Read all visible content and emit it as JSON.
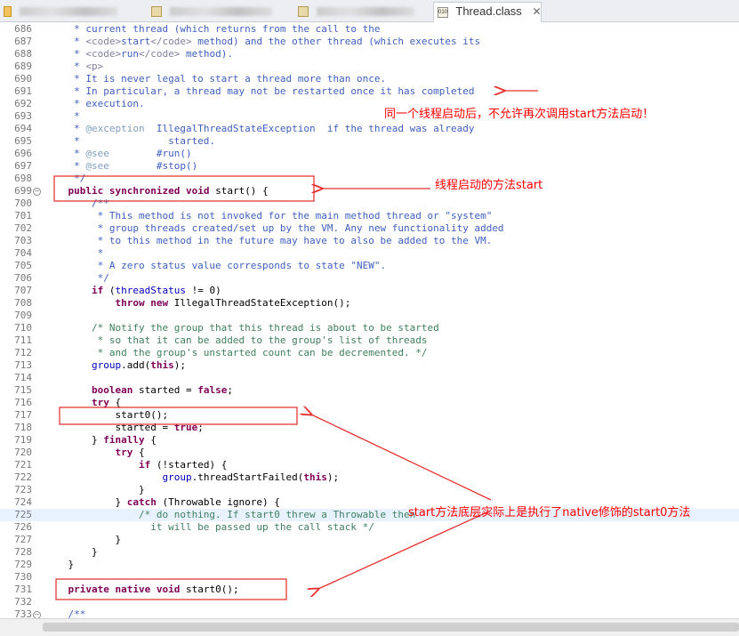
{
  "tabs": [
    {
      "label": "",
      "icon": "java-file-icon",
      "active": false
    },
    {
      "label": "",
      "icon": "class-file-icon",
      "active": false
    },
    {
      "label": "",
      "icon": "class-file-icon",
      "active": false
    },
    {
      "label": "Thread.class",
      "icon": "class-file-icon",
      "active": true,
      "close": "✕"
    }
  ],
  "code_lines": [
    {
      "n": "686",
      "t": [
        [
          "c-cm",
          "     * current thread (which returns from the call to the"
        ]
      ]
    },
    {
      "n": "687",
      "t": [
        [
          "c-cm",
          "     * "
        ],
        [
          "c-tag",
          "<code>"
        ],
        [
          "c-cm",
          "start"
        ],
        [
          "c-tag",
          "</code>"
        ],
        [
          "c-cm",
          " method) and the other thread (which executes its"
        ]
      ]
    },
    {
      "n": "688",
      "t": [
        [
          "c-cm",
          "     * "
        ],
        [
          "c-tag",
          "<code>"
        ],
        [
          "c-cm",
          "run"
        ],
        [
          "c-tag",
          "</code>"
        ],
        [
          "c-cm",
          " method)."
        ]
      ]
    },
    {
      "n": "689",
      "t": [
        [
          "c-cm",
          "     * "
        ],
        [
          "c-tag",
          "<p>"
        ]
      ]
    },
    {
      "n": "690",
      "t": [
        [
          "c-cm",
          "     * It is never legal to start a thread more than once."
        ]
      ]
    },
    {
      "n": "691",
      "t": [
        [
          "c-cm",
          "     * In particular, a thread may not be restarted once it has completed"
        ]
      ]
    },
    {
      "n": "692",
      "t": [
        [
          "c-cm",
          "     * execution."
        ]
      ]
    },
    {
      "n": "693",
      "t": [
        [
          "c-cm",
          "     *"
        ]
      ]
    },
    {
      "n": "694",
      "t": [
        [
          "c-cm",
          "     * "
        ],
        [
          "c-jd",
          "@exception"
        ],
        [
          "c-cm",
          "  IllegalThreadStateException  if the thread was already"
        ]
      ]
    },
    {
      "n": "695",
      "t": [
        [
          "c-cm",
          "     *               started."
        ]
      ]
    },
    {
      "n": "696",
      "t": [
        [
          "c-cm",
          "     * "
        ],
        [
          "c-jd",
          "@see"
        ],
        [
          "c-cm",
          "        #run()"
        ]
      ]
    },
    {
      "n": "697",
      "t": [
        [
          "c-cm",
          "     * "
        ],
        [
          "c-jd",
          "@see"
        ],
        [
          "c-cm",
          "        #stop()"
        ]
      ]
    },
    {
      "n": "698",
      "t": [
        [
          "c-cm",
          "     */"
        ]
      ]
    },
    {
      "n": "699",
      "fold": "−",
      "t": [
        [
          "c-pl",
          "    "
        ],
        [
          "c-kw",
          "public synchronized void"
        ],
        [
          "c-pl",
          " start() {"
        ]
      ]
    },
    {
      "n": "700",
      "t": [
        [
          "c-cm",
          "        /**"
        ]
      ]
    },
    {
      "n": "701",
      "t": [
        [
          "c-cm",
          "         * This method is not invoked for the main method thread or \"system\""
        ]
      ]
    },
    {
      "n": "702",
      "t": [
        [
          "c-cm",
          "         * group threads created/set up by the VM. Any new functionality added"
        ]
      ]
    },
    {
      "n": "703",
      "t": [
        [
          "c-cm",
          "         * to this method in the future may have to also be added to the VM."
        ]
      ]
    },
    {
      "n": "704",
      "t": [
        [
          "c-cm",
          "         *"
        ]
      ]
    },
    {
      "n": "705",
      "t": [
        [
          "c-cm",
          "         * A zero status value corresponds to state \"NEW\"."
        ]
      ]
    },
    {
      "n": "706",
      "t": [
        [
          "c-cm",
          "         */"
        ]
      ]
    },
    {
      "n": "707",
      "t": [
        [
          "c-pl",
          "        "
        ],
        [
          "c-kw",
          "if"
        ],
        [
          "c-pl",
          " ("
        ],
        [
          "c-fld",
          "threadStatus"
        ],
        [
          "c-pl",
          " != 0)"
        ]
      ]
    },
    {
      "n": "708",
      "t": [
        [
          "c-pl",
          "            "
        ],
        [
          "c-kw",
          "throw new"
        ],
        [
          "c-pl",
          " IllegalThreadStateException();"
        ]
      ]
    },
    {
      "n": "709",
      "t": []
    },
    {
      "n": "710",
      "t": [
        [
          "c-mc",
          "        /* Notify the group that this thread is about to be started"
        ]
      ]
    },
    {
      "n": "711",
      "t": [
        [
          "c-mc",
          "         * so that it can be added to the group's list of threads"
        ]
      ]
    },
    {
      "n": "712",
      "t": [
        [
          "c-mc",
          "         * and the group's unstarted count can be decremented. */"
        ]
      ]
    },
    {
      "n": "713",
      "t": [
        [
          "c-pl",
          "        "
        ],
        [
          "c-fld",
          "group"
        ],
        [
          "c-pl",
          ".add("
        ],
        [
          "c-kw",
          "this"
        ],
        [
          "c-pl",
          ");"
        ]
      ]
    },
    {
      "n": "714",
      "t": []
    },
    {
      "n": "715",
      "t": [
        [
          "c-pl",
          "        "
        ],
        [
          "c-kw",
          "boolean"
        ],
        [
          "c-pl",
          " started = "
        ],
        [
          "c-kw",
          "false"
        ],
        [
          "c-pl",
          ";"
        ]
      ]
    },
    {
      "n": "716",
      "t": [
        [
          "c-pl",
          "        "
        ],
        [
          "c-kw",
          "try"
        ],
        [
          "c-pl",
          " {"
        ]
      ]
    },
    {
      "n": "717",
      "t": [
        [
          "c-pl",
          "            start0();"
        ]
      ]
    },
    {
      "n": "718",
      "t": [
        [
          "c-pl",
          "            started = "
        ],
        [
          "c-kw",
          "true"
        ],
        [
          "c-pl",
          ";"
        ]
      ]
    },
    {
      "n": "719",
      "t": [
        [
          "c-pl",
          "        } "
        ],
        [
          "c-kw",
          "finally"
        ],
        [
          "c-pl",
          " {"
        ]
      ]
    },
    {
      "n": "720",
      "t": [
        [
          "c-pl",
          "            "
        ],
        [
          "c-kw",
          "try"
        ],
        [
          "c-pl",
          " {"
        ]
      ]
    },
    {
      "n": "721",
      "t": [
        [
          "c-pl",
          "                "
        ],
        [
          "c-kw",
          "if"
        ],
        [
          "c-pl",
          " (!started) {"
        ]
      ]
    },
    {
      "n": "722",
      "t": [
        [
          "c-pl",
          "                    "
        ],
        [
          "c-fld",
          "group"
        ],
        [
          "c-pl",
          ".threadStartFailed("
        ],
        [
          "c-kw",
          "this"
        ],
        [
          "c-pl",
          ");"
        ]
      ]
    },
    {
      "n": "723",
      "t": [
        [
          "c-pl",
          "                }"
        ]
      ]
    },
    {
      "n": "724",
      "t": [
        [
          "c-pl",
          "            } "
        ],
        [
          "c-kw",
          "catch"
        ],
        [
          "c-pl",
          " (Throwable ignore) {"
        ]
      ]
    },
    {
      "n": "725",
      "hl": true,
      "t": [
        [
          "c-mc",
          "                /* do nothing. If start0 threw a Throwable then"
        ]
      ]
    },
    {
      "n": "726",
      "t": [
        [
          "c-mc",
          "                  it will be passed up the call stack */"
        ]
      ]
    },
    {
      "n": "727",
      "t": [
        [
          "c-pl",
          "            }"
        ]
      ]
    },
    {
      "n": "728",
      "t": [
        [
          "c-pl",
          "        }"
        ]
      ]
    },
    {
      "n": "729",
      "t": [
        [
          "c-pl",
          "    }"
        ]
      ]
    },
    {
      "n": "730",
      "t": []
    },
    {
      "n": "731",
      "t": [
        [
          "c-pl",
          "    "
        ],
        [
          "c-kw",
          "private native void"
        ],
        [
          "c-pl",
          " start0();"
        ]
      ]
    },
    {
      "n": "732",
      "t": []
    },
    {
      "n": "733",
      "fold": "−",
      "t": [
        [
          "c-cm",
          "    /**"
        ]
      ]
    }
  ],
  "annotations": {
    "note1": "同一个线程启动后，不允许再次调用start方法启动！",
    "note2": "线程启动的方法start",
    "note3": "start方法底层实际上是执行了native修饰的start0方法"
  },
  "colors": {
    "annotation": "#ff0000",
    "keyword": "#7f0055",
    "javadoc": "#3f5fbf",
    "comment": "#3f7f5f",
    "field": "#0000c0"
  }
}
